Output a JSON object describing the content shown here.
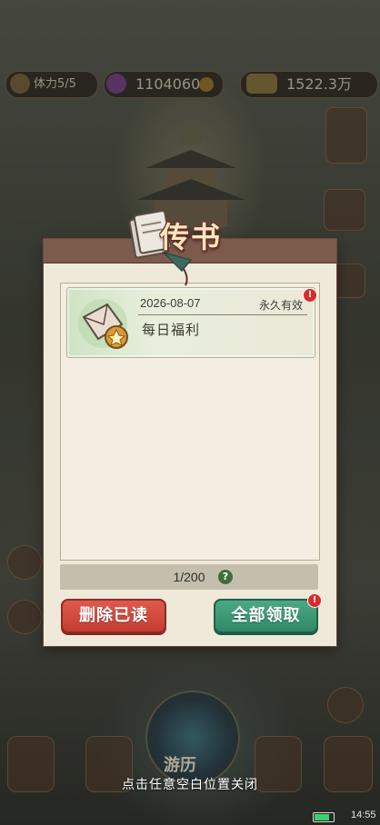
{
  "topbar": {
    "energy_text": "体力5/5",
    "gems_text": "1104060",
    "coins_text": "1522.3万"
  },
  "dialog": {
    "title": "传书",
    "mail": [
      {
        "date": "2026-08-07",
        "validity": "永久有效",
        "title": "每日福利",
        "badge": "!"
      }
    ],
    "count": "1/200",
    "help": "?",
    "delete_label": "删除已读",
    "collect_label": "全部领取",
    "collect_badge": "!"
  },
  "dock": {
    "center_label": "游历"
  },
  "hint": "点击任意空白位置关闭",
  "status": {
    "time": "14:55",
    "battery_level": 0.8
  },
  "colors": {
    "delete_button": "#c23b32",
    "collect_button": "#2d8766",
    "dialog_bg": "#efe9da",
    "header": "#7c5a4c"
  }
}
